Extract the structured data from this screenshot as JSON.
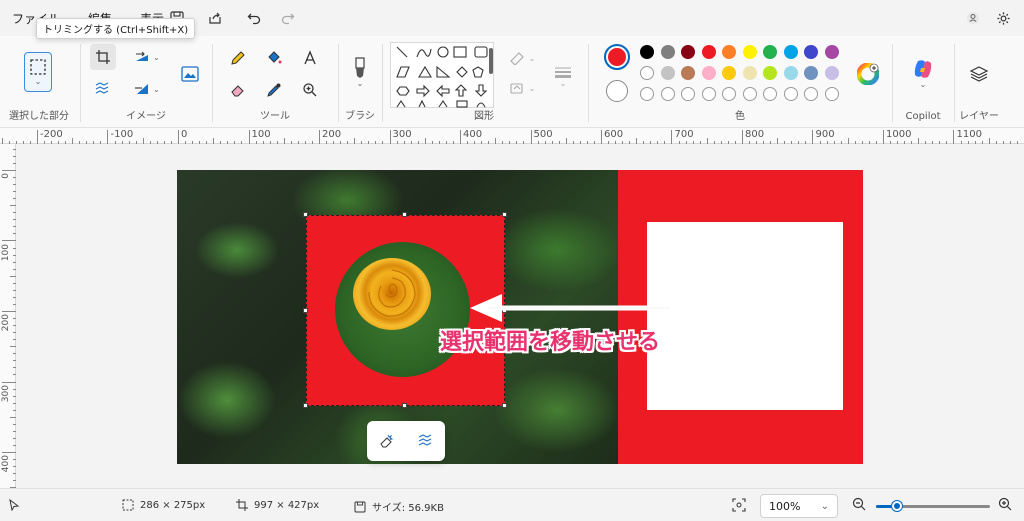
{
  "menu": {
    "file": "ファイル",
    "edit": "編集",
    "view": "表示"
  },
  "tooltip": "トリミングする (Ctrl+Shift+X)",
  "ribbon": {
    "groups": {
      "selection": "選択した部分",
      "image": "イメージ",
      "tools": "ツール",
      "brushes": "ブラシ",
      "shapes": "図形",
      "colors": "色",
      "copilot": "Copilot",
      "layers": "レイヤー"
    }
  },
  "colors": {
    "primary": "#ed1c24",
    "secondary": "#ffffff",
    "palette_row1": [
      "#000000",
      "#7f7f7f",
      "#880015",
      "#ed1c24",
      "#ff7f27",
      "#fff200",
      "#22b14c",
      "#00a2e8",
      "#3f48cc",
      "#a349a4"
    ],
    "palette_row2": [
      "#ffffff",
      "#c3c3c3",
      "#b97a57",
      "#ffaec9",
      "#ffc90e",
      "#efe4b0",
      "#b5e61d",
      "#99d9ea",
      "#7092be",
      "#c8bfe7"
    ]
  },
  "ruler": {
    "h_labels": [
      "-200",
      "-100",
      "0",
      "100",
      "200",
      "300",
      "400",
      "500",
      "600",
      "700",
      "800",
      "900",
      "1000",
      "1100"
    ],
    "v_labels": [
      "0",
      "100",
      "200",
      "300",
      "400"
    ]
  },
  "annotation": "選択範囲を移動させる",
  "status": {
    "selection_size": "286 × 275px",
    "canvas_size": "997 × 427px",
    "file_size": "サイズ: 56.9KB",
    "zoom": "100%",
    "zoom_level": 0.18
  }
}
